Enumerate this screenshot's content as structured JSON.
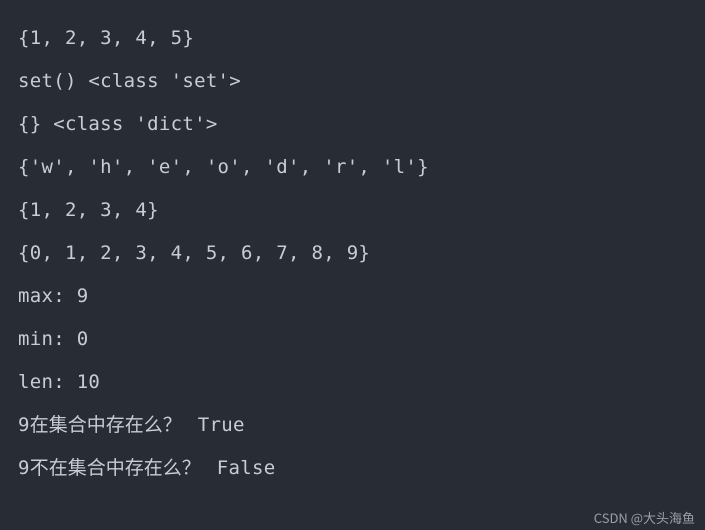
{
  "lines": [
    {
      "prefix": "",
      "cjk": "",
      "suffix": "{1, 2, 3, 4, 5}"
    },
    {
      "prefix": "",
      "cjk": "",
      "suffix": "set() <class 'set'>"
    },
    {
      "prefix": "",
      "cjk": "",
      "suffix": "{} <class 'dict'>"
    },
    {
      "prefix": "",
      "cjk": "",
      "suffix": "{'w', 'h', 'e', 'o', 'd', 'r', 'l'}"
    },
    {
      "prefix": "",
      "cjk": "",
      "suffix": "{1, 2, 3, 4}"
    },
    {
      "prefix": "",
      "cjk": "",
      "suffix": "{0, 1, 2, 3, 4, 5, 6, 7, 8, 9}"
    },
    {
      "prefix": "",
      "cjk": "",
      "suffix": "max: 9"
    },
    {
      "prefix": "",
      "cjk": "",
      "suffix": "min: 0"
    },
    {
      "prefix": "",
      "cjk": "",
      "suffix": "len: 10"
    },
    {
      "prefix": "9",
      "cjk": "在集合中存在么？ ",
      "suffix": " True"
    },
    {
      "prefix": "9",
      "cjk": "不在集合中存在么？ ",
      "suffix": " False"
    }
  ],
  "watermark": "CSDN @大头海鱼"
}
